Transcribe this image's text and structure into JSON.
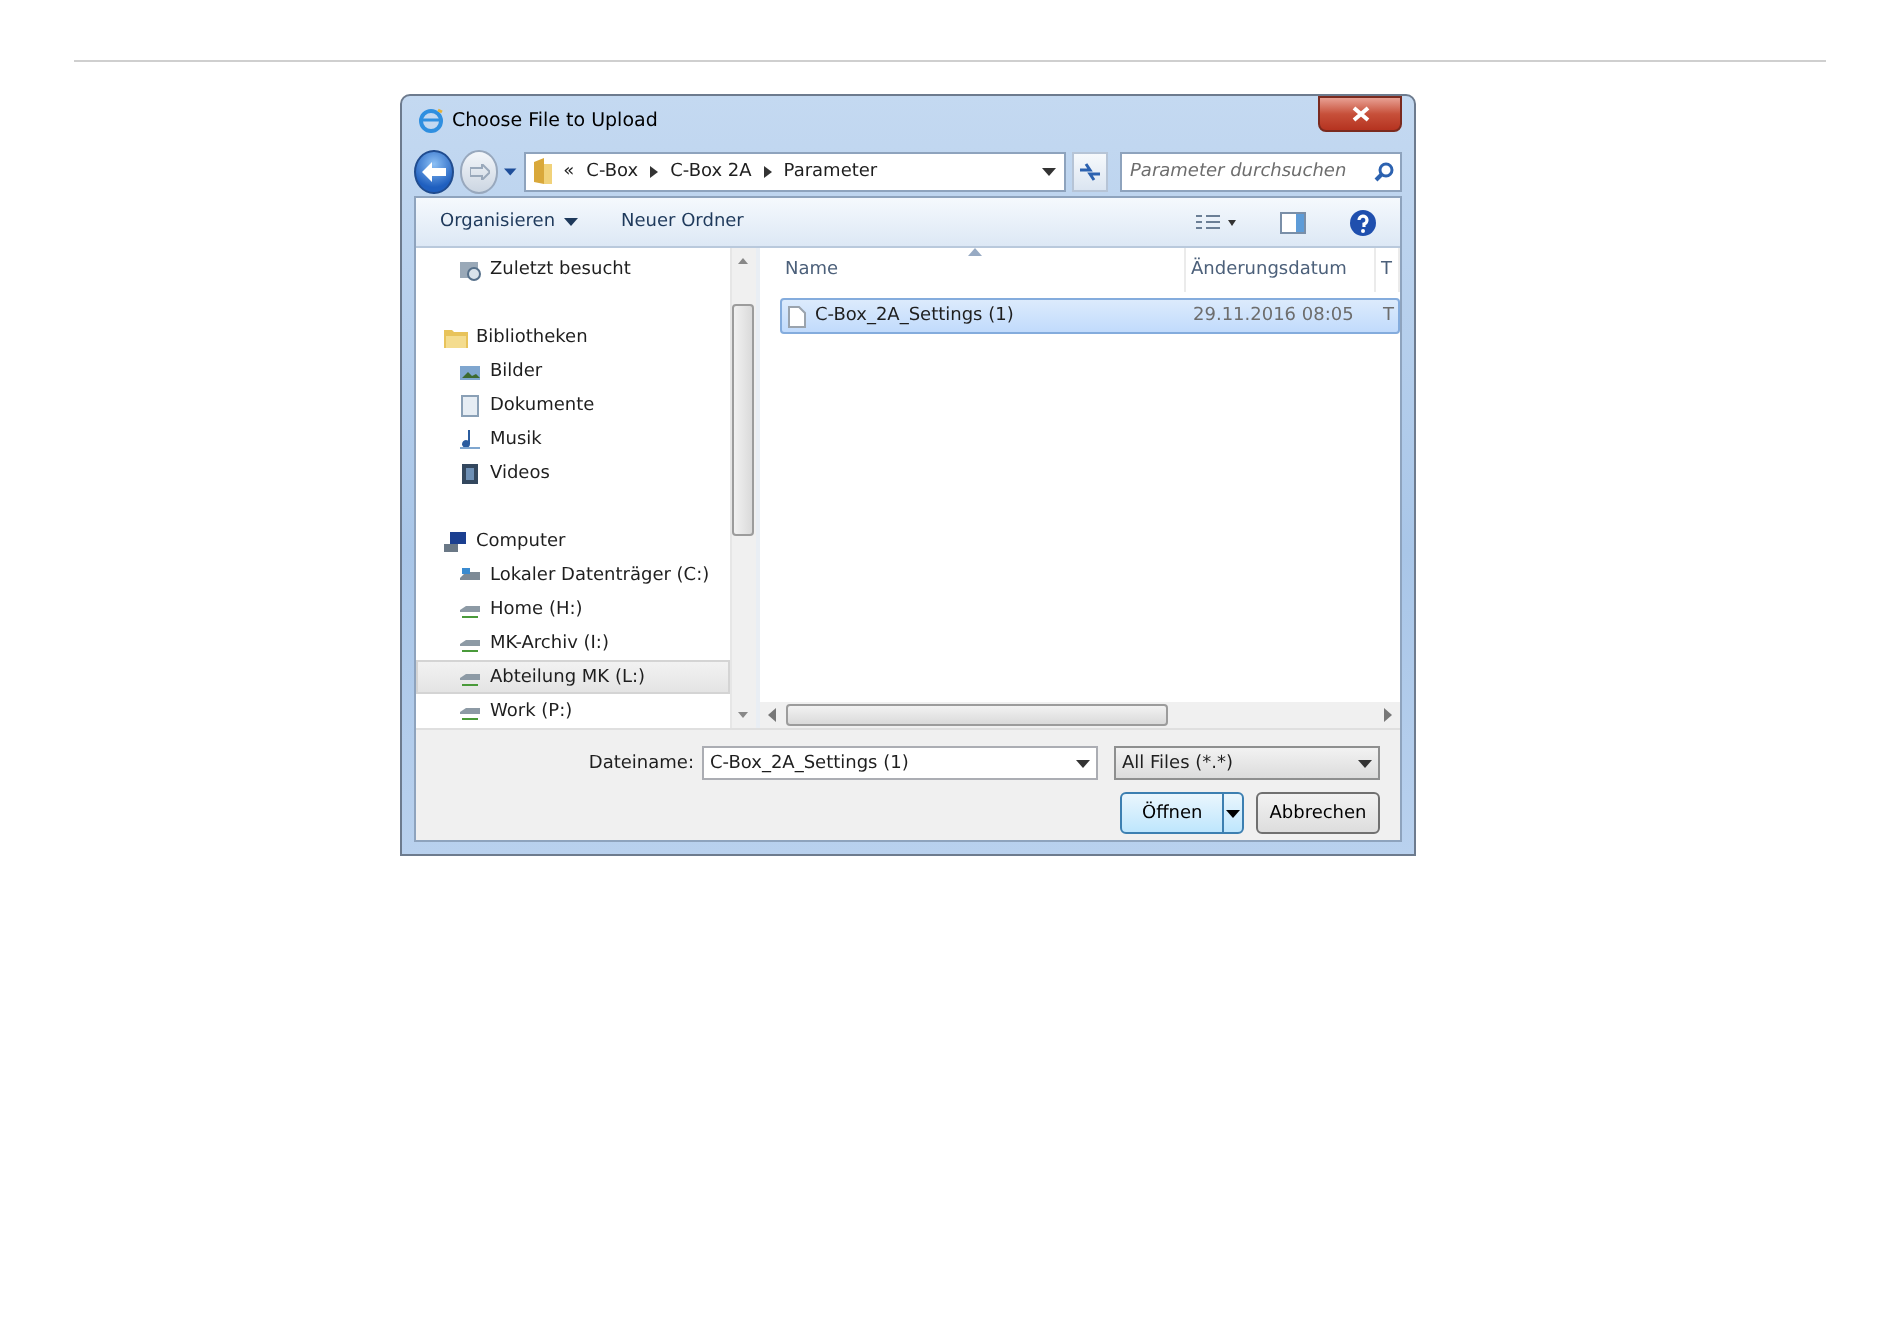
{
  "window": {
    "title": "Choose File to Upload"
  },
  "address": {
    "path": [
      {
        "label": "«"
      },
      {
        "label": "C-Box"
      },
      {
        "label": "C-Box 2A"
      },
      {
        "label": "Parameter"
      }
    ],
    "search_placeholder": "Parameter durchsuchen"
  },
  "toolbar": {
    "items": [
      "Organisieren",
      "Neuer Ordner"
    ]
  },
  "navigation": [
    {
      "label": "Zuletzt besucht",
      "kind": "recent",
      "selected": false
    },
    {
      "label": "Bibliotheken",
      "kind": "library",
      "selected": false,
      "children": [
        {
          "label": "Bilder",
          "kind": "pictures",
          "selected": false
        },
        {
          "label": "Dokumente",
          "kind": "documents",
          "selected": false
        },
        {
          "label": "Musik",
          "kind": "music",
          "selected": false
        },
        {
          "label": "Videos",
          "kind": "videos",
          "selected": false
        }
      ]
    },
    {
      "label": "Computer",
      "kind": "computer",
      "selected": false,
      "children": [
        {
          "label": "Lokaler Datenträger (C:)",
          "kind": "localdrive",
          "selected": false
        },
        {
          "label": "Home (H:)",
          "kind": "netdrive",
          "selected": false
        },
        {
          "label": "MK-Archiv (I:)",
          "kind": "netdrive",
          "selected": false
        },
        {
          "label": "Abteilung MK (L:)",
          "kind": "netdrive",
          "selected": true
        },
        {
          "label": "Work (P:)",
          "kind": "netdrive",
          "selected": false
        }
      ]
    }
  ],
  "file_list": {
    "columns": [
      "Name",
      "Änderungsdatum",
      "T"
    ],
    "rows": [
      {
        "cells": [
          "C-Box_2A_Settings (1)",
          "29.11.2016 08:05",
          "T"
        ],
        "selected": true
      }
    ]
  },
  "filename": {
    "label": "Dateiname:",
    "value": "C-Box_2A_Settings (1)"
  },
  "filter": {
    "value": "All Files (*.*)"
  },
  "buttons": [
    {
      "label": "Öffnen",
      "kind": "split"
    },
    {
      "label": "Abbrechen",
      "kind": "plain"
    }
  ]
}
